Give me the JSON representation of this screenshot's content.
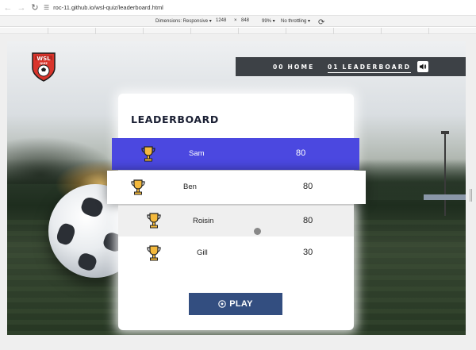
{
  "browser": {
    "url": "roc-11.github.io/wsl-quiz/leaderboard.html"
  },
  "devtools": {
    "dimensions_label": "Dimensions: Responsive",
    "width": "1248",
    "times": "×",
    "height": "848",
    "zoom": "99%",
    "throttling": "No throttling"
  },
  "logo": {
    "text": "WSL",
    "subtext": "QUIZ",
    "primary_color": "#d9342b"
  },
  "nav": {
    "home_num": "00",
    "home_label": "HOME",
    "leaderboard_num": "01",
    "leaderboard_label": "LEADERBOARD",
    "sound_icon": "speaker-icon"
  },
  "leaderboard": {
    "title": "LEADERBOARD",
    "rows": [
      {
        "name": "Sam",
        "score": "80"
      },
      {
        "name": "Ben",
        "score": "80"
      },
      {
        "name": "Roisin",
        "score": "80"
      },
      {
        "name": "Gill",
        "score": "30"
      }
    ],
    "highlight_color": "#4b48e0"
  },
  "play_button": {
    "icon": "soccer-ball-icon",
    "label": "PLAY",
    "color": "#334e80"
  }
}
